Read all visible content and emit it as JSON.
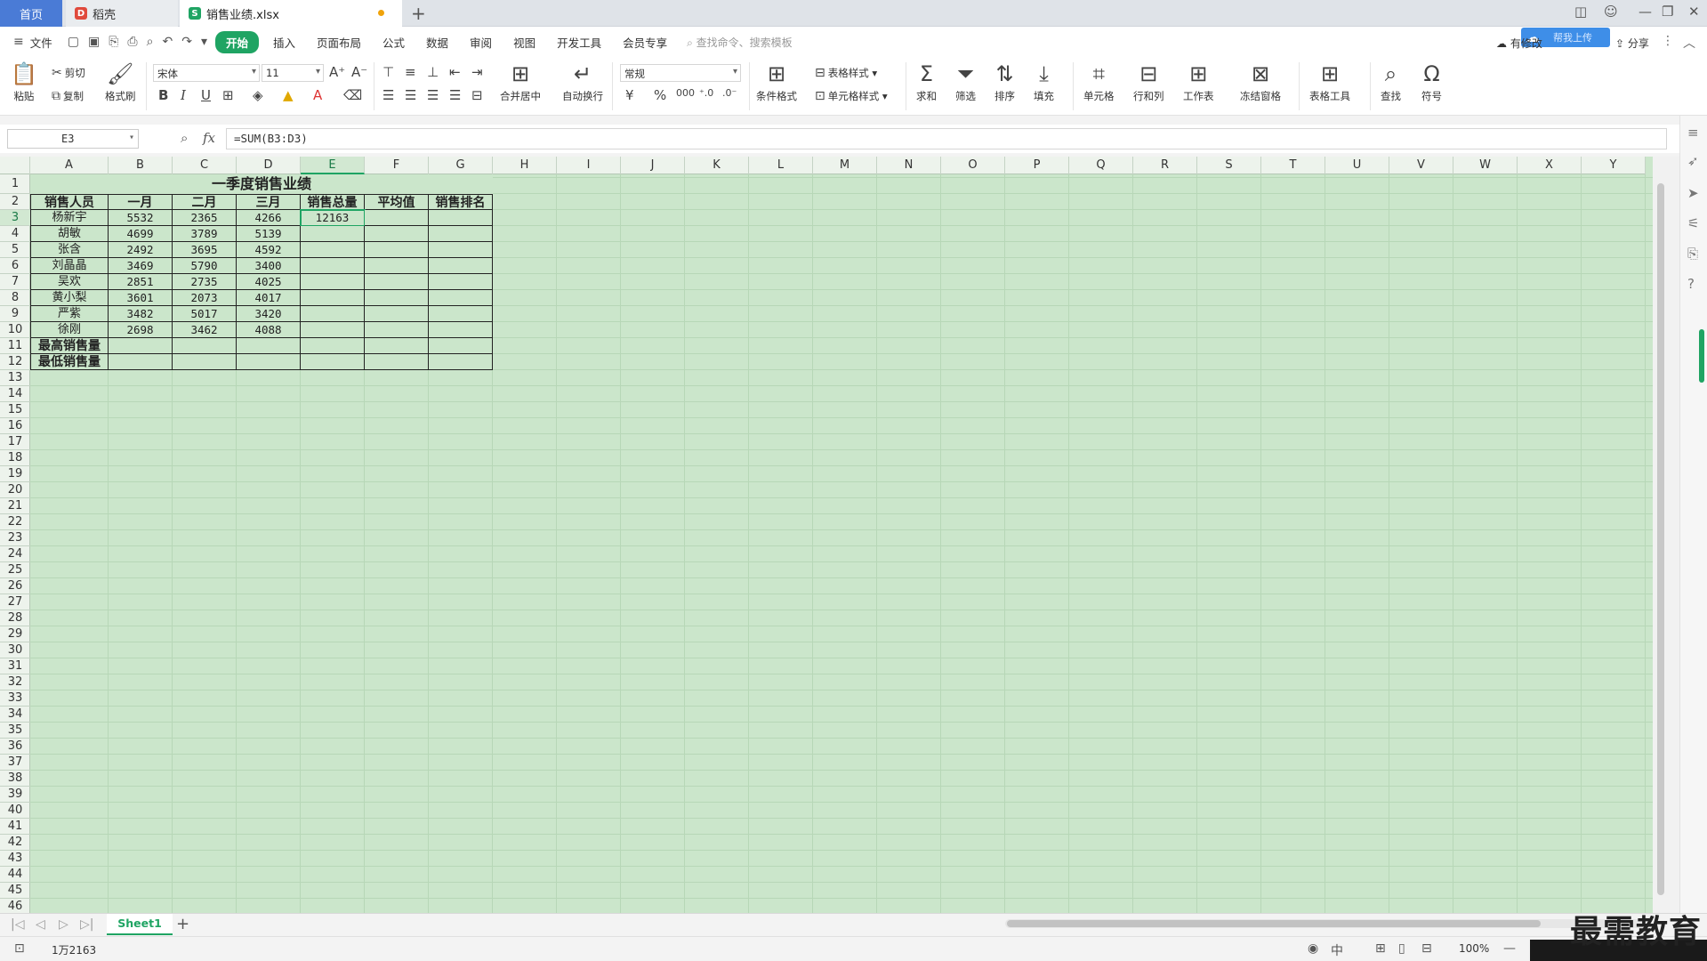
{
  "tabs": {
    "home": "首页",
    "docer": "稻壳",
    "file": "销售业绩.xlsx"
  },
  "menu": {
    "file": "文件",
    "items": [
      "开始",
      "插入",
      "页面布局",
      "公式",
      "数据",
      "审阅",
      "视图",
      "开发工具",
      "会员专享"
    ],
    "search_placeholder": "查找命令、搜索模板",
    "right": {
      "changes": "有修改",
      "share": "分享"
    }
  },
  "ribbon": {
    "paste": "粘贴",
    "cut": "剪切",
    "copy": "复制",
    "format_painter": "格式刷",
    "font_name": "宋体",
    "font_size": "11",
    "merge": "合并居中",
    "wrap": "自动换行",
    "number_format": "常规",
    "cond_format": "条件格式",
    "table_style": "表格样式",
    "cell_style": "单元格样式",
    "sum": "求和",
    "filter": "筛选",
    "sort": "排序",
    "fill": "填充",
    "cell": "单元格",
    "rowcol": "行和列",
    "sheet": "工作表",
    "freeze": "冻结窗格",
    "table_tools": "表格工具",
    "find": "查找",
    "symbol": "符号"
  },
  "formula_bar": {
    "name_box": "E3",
    "formula": "=SUM(B3:D3)"
  },
  "columns": [
    "A",
    "B",
    "C",
    "D",
    "E",
    "F",
    "G",
    "H",
    "I",
    "J",
    "K",
    "L",
    "M",
    "N",
    "O",
    "P",
    "Q",
    "R",
    "S",
    "T",
    "U",
    "V",
    "W",
    "X",
    "Y"
  ],
  "sheet": {
    "title": "一季度销售业绩",
    "headers": [
      "销售人员",
      "一月",
      "二月",
      "三月",
      "销售总量",
      "平均值",
      "销售排名"
    ],
    "rows": [
      [
        "杨新宇",
        "5532",
        "2365",
        "4266",
        "12163",
        "",
        ""
      ],
      [
        "胡敏",
        "4699",
        "3789",
        "5139",
        "",
        "",
        ""
      ],
      [
        "张含",
        "2492",
        "3695",
        "4592",
        "",
        "",
        ""
      ],
      [
        "刘晶晶",
        "3469",
        "5790",
        "3400",
        "",
        "",
        ""
      ],
      [
        "吴欢",
        "2851",
        "2735",
        "4025",
        "",
        "",
        ""
      ],
      [
        "黄小梨",
        "3601",
        "2073",
        "4017",
        "",
        "",
        ""
      ],
      [
        "严紫",
        "3482",
        "5017",
        "3420",
        "",
        "",
        ""
      ],
      [
        "徐刚",
        "2698",
        "3462",
        "4088",
        "",
        "",
        ""
      ]
    ],
    "summary_rows": [
      "最高销售量",
      "最低销售量"
    ]
  },
  "sheet_tab": "Sheet1",
  "status": {
    "sum": "1万2163",
    "zoom": "100%"
  },
  "watermark": "最需教育",
  "badge": "帮我上传"
}
